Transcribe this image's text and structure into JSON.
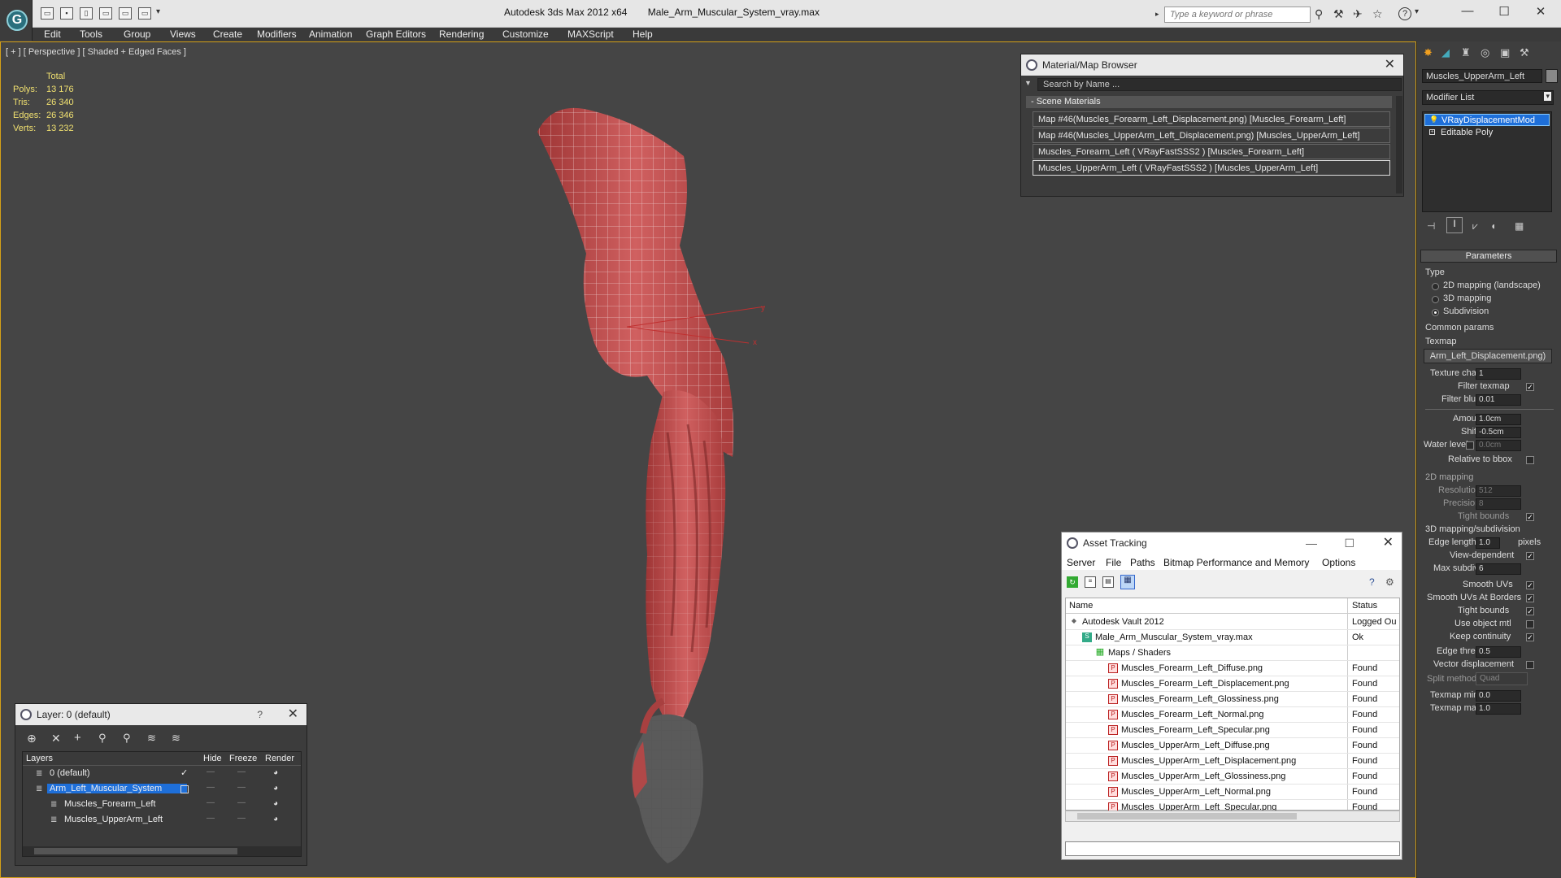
{
  "title_bar": {
    "app_title": "Autodesk 3ds Max  2012 x64",
    "file_name": "Male_Arm_Muscular_System_vray.max",
    "search_placeholder": "Type a keyword or phrase"
  },
  "menu": [
    "Edit",
    "Tools",
    "Group",
    "Views",
    "Create",
    "Modifiers",
    "Animation",
    "Graph Editors",
    "Rendering",
    "Customize",
    "MAXScript",
    "Help"
  ],
  "viewport": {
    "label": "[ + ] [ Perspective ] [ Shaded + Edged Faces ]",
    "stats_header": "Total",
    "stats": [
      {
        "label": "Polys:",
        "value": "13 176"
      },
      {
        "label": "Tris:",
        "value": "26 340"
      },
      {
        "label": "Edges:",
        "value": "26 346"
      },
      {
        "label": "Verts:",
        "value": "13 232"
      }
    ],
    "gizmo": {
      "y": "y",
      "x": "x"
    }
  },
  "material_browser": {
    "title": "Material/Map Browser",
    "search_placeholder": "Search by Name ...",
    "group_label": "- Scene Materials",
    "items": [
      "Map #46(Muscles_Forearm_Left_Displacement.png) [Muscles_Forearm_Left]",
      "Map #46(Muscles_UpperArm_Left_Displacement.png) [Muscles_UpperArm_Left]",
      "Muscles_Forearm_Left  ( VRayFastSSS2 ) [Muscles_Forearm_Left]",
      "Muscles_UpperArm_Left  ( VRayFastSSS2 ) [Muscles_UpperArm_Left]"
    ]
  },
  "asset_tracking": {
    "title": "Asset Tracking",
    "menus": [
      "Server",
      "File",
      "Paths",
      "Bitmap Performance and Memory",
      "Options"
    ],
    "columns": [
      "Name",
      "Status"
    ],
    "rows": [
      {
        "name": "Autodesk Vault 2012",
        "status": "Logged Ou",
        "level": 0,
        "icon": "vault-icon"
      },
      {
        "name": "Male_Arm_Muscular_System_vray.max",
        "status": "Ok",
        "level": 1,
        "icon": "max-file-icon"
      },
      {
        "name": "Maps / Shaders",
        "status": "",
        "level": 2,
        "icon": "maps-icon"
      },
      {
        "name": "Muscles_Forearm_Left_Diffuse.png",
        "status": "Found",
        "level": 3,
        "icon": "png-icon"
      },
      {
        "name": "Muscles_Forearm_Left_Displacement.png",
        "status": "Found",
        "level": 3,
        "icon": "png-icon"
      },
      {
        "name": "Muscles_Forearm_Left_Glossiness.png",
        "status": "Found",
        "level": 3,
        "icon": "png-icon"
      },
      {
        "name": "Muscles_Forearm_Left_Normal.png",
        "status": "Found",
        "level": 3,
        "icon": "png-icon"
      },
      {
        "name": "Muscles_Forearm_Left_Specular.png",
        "status": "Found",
        "level": 3,
        "icon": "png-icon"
      },
      {
        "name": "Muscles_UpperArm_Left_Diffuse.png",
        "status": "Found",
        "level": 3,
        "icon": "png-icon"
      },
      {
        "name": "Muscles_UpperArm_Left_Displacement.png",
        "status": "Found",
        "level": 3,
        "icon": "png-icon"
      },
      {
        "name": "Muscles_UpperArm_Left_Glossiness.png",
        "status": "Found",
        "level": 3,
        "icon": "png-icon"
      },
      {
        "name": "Muscles_UpperArm_Left_Normal.png",
        "status": "Found",
        "level": 3,
        "icon": "png-icon"
      },
      {
        "name": "Muscles_UpperArm_Left_Specular.png",
        "status": "Found",
        "level": 3,
        "icon": "png-icon"
      }
    ]
  },
  "layer_panel": {
    "title": "Layer: 0 (default)",
    "help": "?",
    "columns": [
      "Layers",
      "Hide",
      "Freeze",
      "Render"
    ],
    "rows": [
      {
        "name": "0 (default)",
        "selected": false
      },
      {
        "name": "Arm_Left_Muscular_System",
        "selected": true
      },
      {
        "name": "Muscles_Forearm_Left",
        "selected": false
      },
      {
        "name": "Muscles_UpperArm_Left",
        "selected": false
      }
    ]
  },
  "command_panel": {
    "object_name": "Muscles_UpperArm_Left",
    "modifier_list_label": "Modifier List",
    "stack": [
      "VRayDisplacementMod",
      "Editable Poly"
    ],
    "rollout_title": "Parameters",
    "type_label": "Type",
    "type_options": [
      "2D mapping (landscape)",
      "3D mapping",
      "Subdivision"
    ],
    "common_params_label": "Common params",
    "texmap_label": "Texmap",
    "texmap_value": "Arm_Left_Displacement.png)",
    "texture_chan_label": "Texture chan",
    "texture_chan_value": "1",
    "filter_texmap_label": "Filter texmap",
    "filter_blur_label": "Filter blur",
    "filter_blur_value": "0.01",
    "amount_label": "Amount",
    "amount_value": "1.0cm",
    "shift_label": "Shift",
    "shift_value": "-0.5cm",
    "water_level_label": "Water level",
    "water_level_value": "0.0cm",
    "relative_bbox_label": "Relative to bbox",
    "mapping2d_label": "2D mapping",
    "resolution_label": "Resolution",
    "resolution_value": "512",
    "precision_label": "Precision",
    "precision_value": "8",
    "tight_bounds_label": "Tight bounds",
    "mapping3d_label": "3D mapping/subdivision",
    "edge_length_label": "Edge length",
    "edge_length_value": "1.0",
    "pixels_label": "pixels",
    "view_dependent_label": "View-dependent",
    "max_subdivs_label": "Max subdivs",
    "max_subdivs_value": "6",
    "smooth_uvs_label": "Smooth UVs",
    "smooth_uvs_borders_label": "Smooth UVs At Borders",
    "tight_bounds2_label": "Tight bounds",
    "use_object_mtl_label": "Use object mtl",
    "keep_continuity_label": "Keep continuity",
    "edge_thresh_label": "Edge thresh",
    "edge_thresh_value": "0.5",
    "vector_disp_label": "Vector displacement",
    "split_method_label": "Split method:",
    "split_method_value": "Quad",
    "texmap_min_label": "Texmap min:",
    "texmap_min_value": "0.0",
    "texmap_max_label": "Texmap max:",
    "texmap_max_value": "1.0"
  },
  "colors": {
    "selection": "#1e6fd9",
    "muscle": "#c04a4a",
    "viewport_bg": "#454545",
    "accent": "#d4a017"
  }
}
